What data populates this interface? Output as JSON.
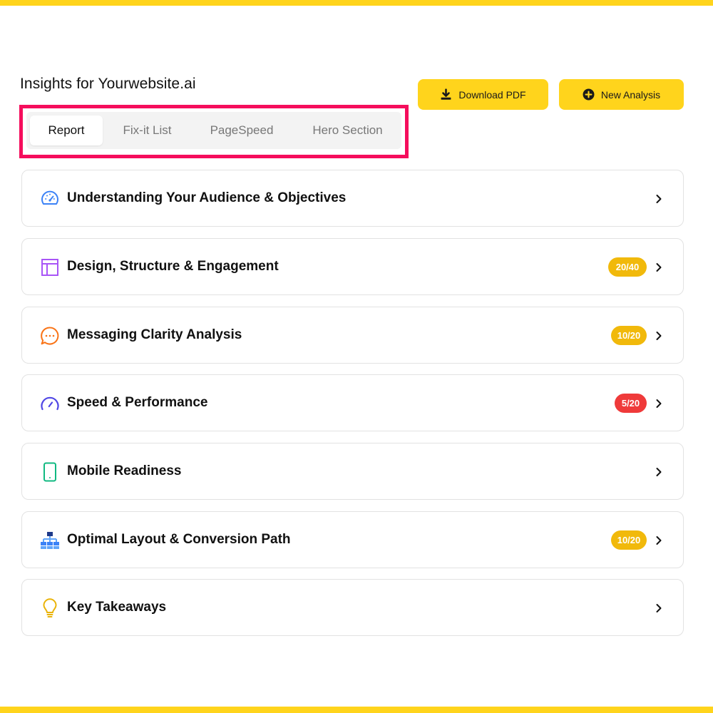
{
  "colors": {
    "accent": "#ffd41c",
    "tab_highlight": "#f50d5c",
    "badge_warning": "#f1b90b",
    "badge_danger": "#ef3a3a"
  },
  "header": {
    "title": "Insights for Yourwebsite.ai",
    "download_button": {
      "label": "Download PDF",
      "icon": "download-icon"
    },
    "new_analysis_button": {
      "label": "New Analysis",
      "icon": "plus-circle-icon"
    }
  },
  "tabs": [
    {
      "label": "Report",
      "active": true
    },
    {
      "label": "Fix-it List",
      "active": false
    },
    {
      "label": "PageSpeed",
      "active": false
    },
    {
      "label": "Hero Section",
      "active": false
    }
  ],
  "sections": [
    {
      "label": "Understanding Your Audience & Objectives",
      "icon": "gauge-icon",
      "badge": ""
    },
    {
      "label": "Design, Structure & Engagement",
      "icon": "layout-icon",
      "badge": "20/40"
    },
    {
      "label": "Messaging Clarity Analysis",
      "icon": "chat-bubble-icon",
      "badge": "10/20"
    },
    {
      "label": "Speed & Performance",
      "icon": "speedometer-icon",
      "badge": "5/20"
    },
    {
      "label": "Mobile Readiness",
      "icon": "mobile-phone-icon",
      "badge": ""
    },
    {
      "label": "Optimal Layout & Conversion Path",
      "icon": "sitemap-icon",
      "badge": "10/20"
    },
    {
      "label": "Key Takeaways",
      "icon": "lightbulb-icon",
      "badge": ""
    }
  ]
}
